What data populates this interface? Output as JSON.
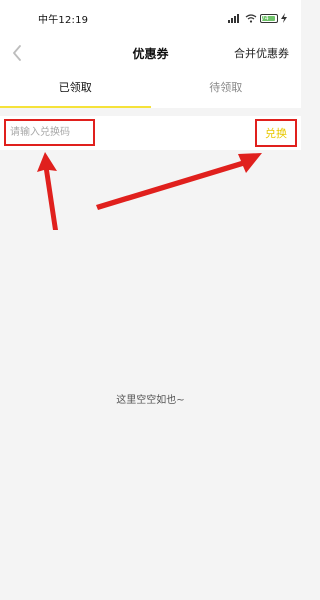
{
  "status_bar": {
    "time": "中午12:19",
    "battery_level": "74",
    "icons": [
      "signal-icon",
      "wifi-icon",
      "battery-icon",
      "charging-icon"
    ]
  },
  "nav": {
    "title": "优惠券",
    "action_label": "合并优惠券",
    "back_icon": "chevron-left-icon"
  },
  "tabs": [
    {
      "label": "已领取",
      "active": true
    },
    {
      "label": "待领取",
      "active": false
    }
  ],
  "redeem": {
    "placeholder": "请输入兑换码",
    "value": "",
    "button_label": "兑换"
  },
  "empty_state": {
    "message": "这里空空如也~"
  },
  "colors": {
    "accent_yellow": "#f5e23a",
    "button_text": "#e8c800",
    "annotation_red": "#e0201d",
    "background": "#f4f4f4"
  }
}
